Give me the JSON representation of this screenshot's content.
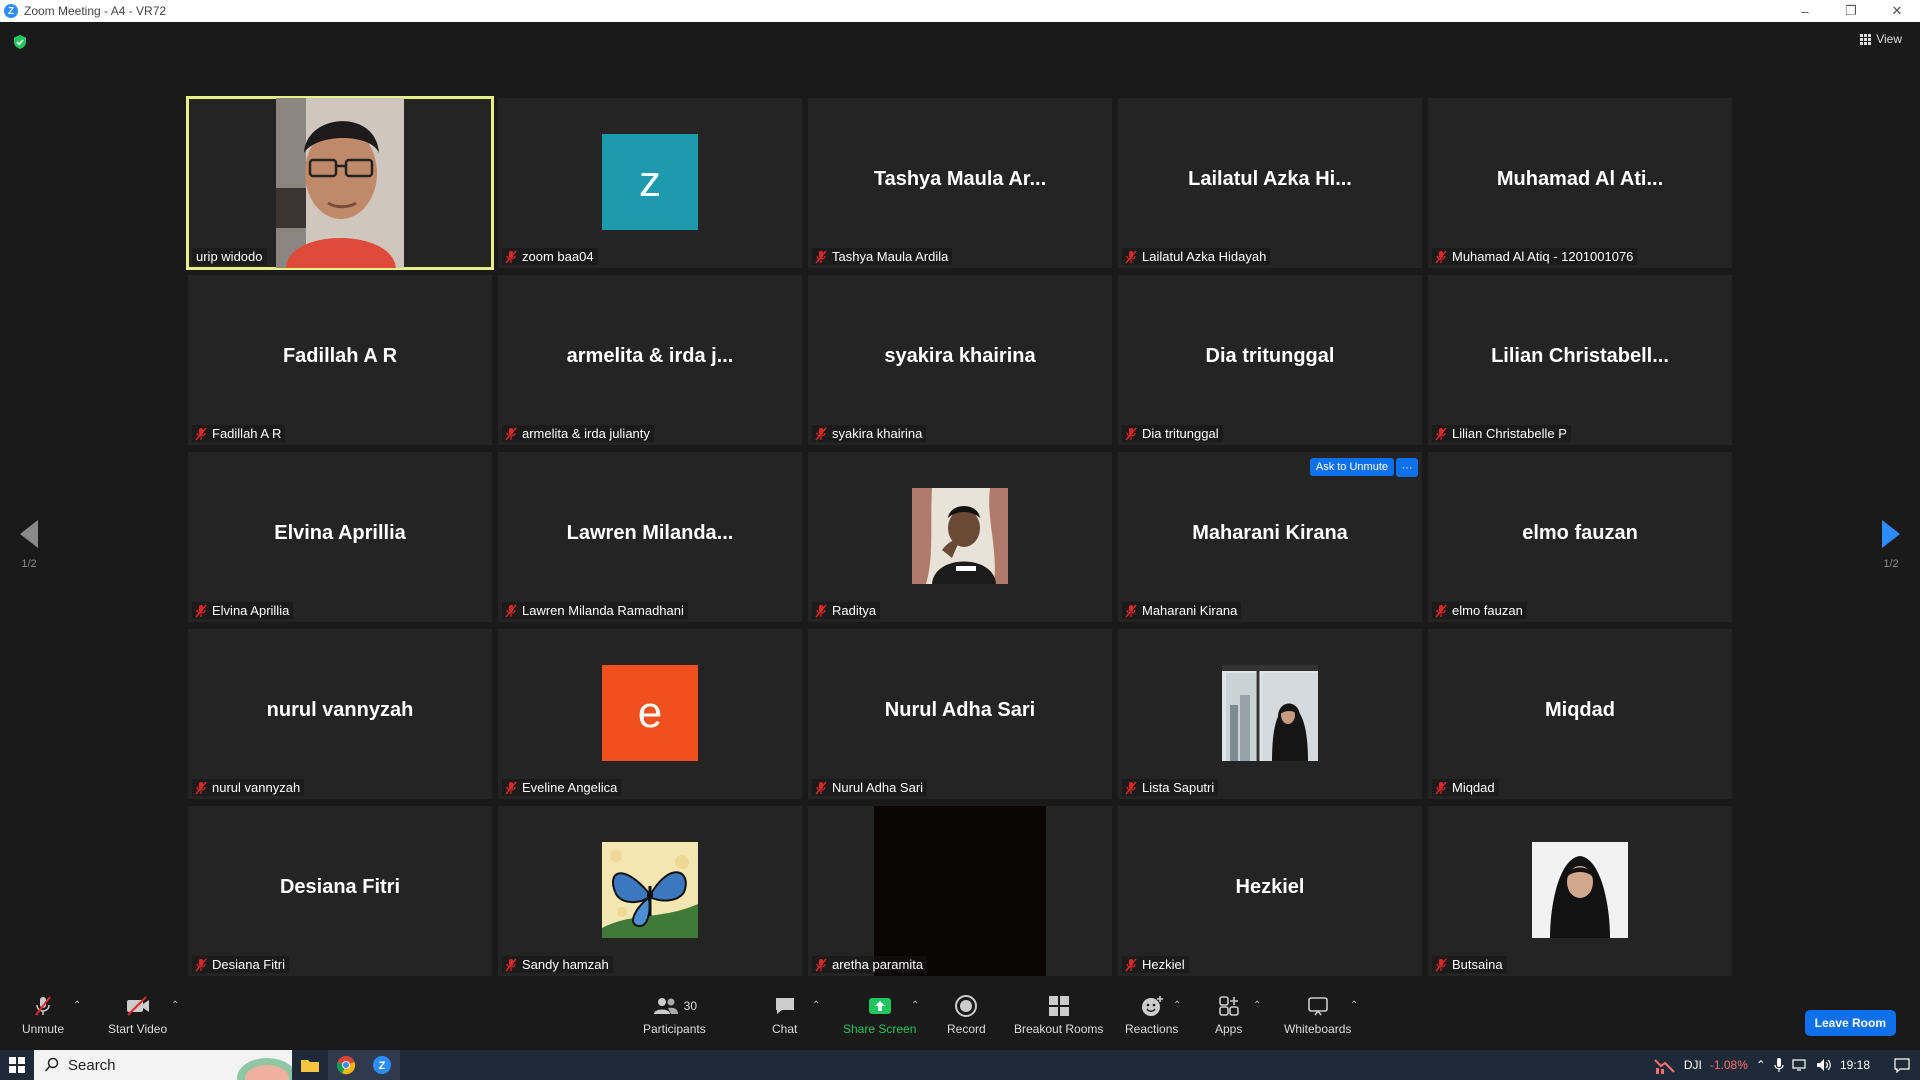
{
  "window": {
    "title": "Zoom Meeting - A4 - VR72"
  },
  "header": {
    "view_label": "View"
  },
  "pagination": {
    "left": "1/2",
    "right": "1/2"
  },
  "tiles": [
    {
      "big": "",
      "label": "urip widodo",
      "muted": false,
      "active": true,
      "kind": "video"
    },
    {
      "big": "",
      "label": "zoom baa04",
      "muted": true,
      "kind": "avatar",
      "letter": "z",
      "color": "#1E9AAF"
    },
    {
      "big": "Tashya Maula Ar...",
      "label": "Tashya Maula Ardila",
      "muted": true
    },
    {
      "big": "Lailatul Azka Hi...",
      "label": "Lailatul Azka Hidayah",
      "muted": true
    },
    {
      "big": "Muhamad Al Ati...",
      "label": "Muhamad Al Atiq - 1201001076",
      "muted": true
    },
    {
      "big": "Fadillah A R",
      "label": "Fadillah A R",
      "muted": true
    },
    {
      "big": "armelita & irda j...",
      "label": "armelita & irda julianty",
      "muted": true
    },
    {
      "big": "syakira khairina",
      "label": "syakira khairina",
      "muted": true
    },
    {
      "big": "Dia tritunggal",
      "label": "Dia tritunggal",
      "muted": true
    },
    {
      "big": "Lilian Christabell...",
      "label": "Lilian Christabelle P",
      "muted": true
    },
    {
      "big": "Elvina Aprillia",
      "label": "Elvina Aprillia",
      "muted": true
    },
    {
      "big": "Lawren Milanda...",
      "label": "Lawren Milanda Ramadhani",
      "muted": true
    },
    {
      "big": "",
      "label": "Raditya",
      "muted": true,
      "kind": "photo-boy"
    },
    {
      "big": "Maharani Kirana",
      "label": "Maharani Kirana",
      "muted": true,
      "ask": true
    },
    {
      "big": "elmo fauzan",
      "label": "elmo fauzan",
      "muted": true
    },
    {
      "big": "nurul vannyzah",
      "label": "nurul vannyzah",
      "muted": true
    },
    {
      "big": "",
      "label": "Eveline Angelica",
      "muted": true,
      "kind": "avatar",
      "letter": "e",
      "color": "#F0501E"
    },
    {
      "big": "Nurul Adha Sari",
      "label": "Nurul Adha Sari",
      "muted": true
    },
    {
      "big": "",
      "label": "Lista Saputri",
      "muted": true,
      "kind": "photo-window"
    },
    {
      "big": "Miqdad",
      "label": "Miqdad",
      "muted": true
    },
    {
      "big": "Desiana Fitri",
      "label": "Desiana Fitri",
      "muted": true
    },
    {
      "big": "",
      "label": "Sandy hamzah",
      "muted": true,
      "kind": "photo-butterfly"
    },
    {
      "big": "",
      "label": "aretha paramita",
      "muted": true,
      "kind": "dark-video"
    },
    {
      "big": "Hezkiel",
      "label": "Hezkiel",
      "muted": true
    },
    {
      "big": "",
      "label": "Butsaina",
      "muted": true,
      "kind": "photo-hijab"
    }
  ],
  "ask_to_unmute": {
    "label": "Ask to Unmute",
    "more": "···"
  },
  "toolbar": {
    "unmute": "Unmute",
    "start_video": "Start Video",
    "participants": "Participants",
    "participants_count": "30",
    "chat": "Chat",
    "share_screen": "Share Screen",
    "record": "Record",
    "breakout_rooms": "Breakout Rooms",
    "reactions": "Reactions",
    "apps": "Apps",
    "whiteboards": "Whiteboards",
    "leave": "Leave Room",
    "share_color": "#22c55e",
    "leave_color": "#0E71EB"
  },
  "taskbar": {
    "search": "Search",
    "stock_name": "DJI",
    "stock_change": "-1.08%",
    "time": "19:18"
  }
}
